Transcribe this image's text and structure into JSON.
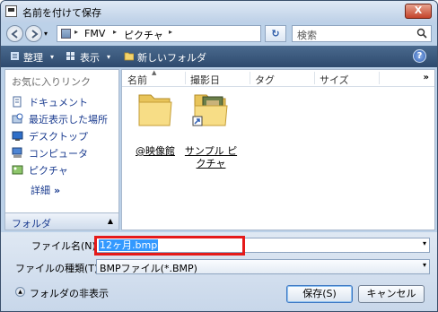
{
  "window": {
    "title": "名前を付けて保存",
    "close_label": "X"
  },
  "address": {
    "crumbs": [
      "FMV",
      "ピクチャ"
    ]
  },
  "search": {
    "placeholder": "検索"
  },
  "toolbar": {
    "organize": "整理",
    "views": "表示",
    "new_folder": "新しいフォルダ",
    "help": "?"
  },
  "sidebar": {
    "header": "お気に入りリンク",
    "items": [
      {
        "label": "ドキュメント",
        "icon": "document-icon"
      },
      {
        "label": "最近表示した場所",
        "icon": "recent-places-icon"
      },
      {
        "label": "デスクトップ",
        "icon": "desktop-icon"
      },
      {
        "label": "コンピュータ",
        "icon": "computer-icon"
      },
      {
        "label": "ピクチャ",
        "icon": "pictures-icon"
      }
    ],
    "more": "詳細",
    "folders_pane": "フォルダ"
  },
  "columns": [
    "名前",
    "撮影日",
    "タグ",
    "サイズ"
  ],
  "files": [
    {
      "line1": "@映像館",
      "line2": ""
    },
    {
      "line1": "サンプル ピ",
      "line2": "クチャ"
    }
  ],
  "bottom": {
    "filename_label": "ファイル名(N):",
    "filename_value": "12ヶ月.bmp",
    "filetype_label": "ファイルの種類(T):",
    "filetype_value": "BMPファイル(*.BMP)",
    "hide_folders": "フォルダの非表示",
    "save": "保存(S)",
    "cancel": "キャンセル"
  },
  "colors": {
    "highlight": "#e51a1a",
    "toolbar": "#2e4a6e",
    "link": "#1a3b8f"
  }
}
